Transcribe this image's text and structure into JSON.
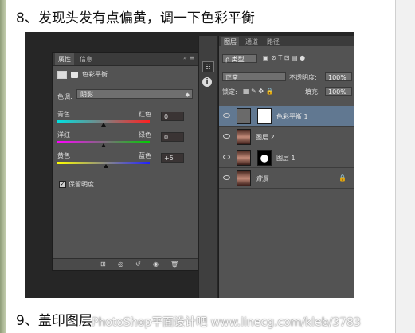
{
  "heading": "8、发现头发有点偏黄，调一下色彩平衡",
  "next_heading": "9、盖印图层",
  "watermark": "PhotoShop平面设计吧 www.linecg.com/kleb/3783",
  "properties_panel": {
    "tabs": [
      "属性",
      "信息"
    ],
    "title": "色彩平衡",
    "tone_label": "色调:",
    "tone_value": "阴影",
    "sliders": [
      {
        "left": "青色",
        "right": "红色",
        "value": "0",
        "level": 0
      },
      {
        "left": "洋红",
        "right": "绿色",
        "value": "0",
        "level": 0
      },
      {
        "left": "黄色",
        "right": "蓝色",
        "value": "+5",
        "level": 5
      }
    ],
    "preserve_luminosity_label": "保留明度",
    "preserve_luminosity_checked": true
  },
  "layers_panel": {
    "tabs": [
      "图层",
      "通道",
      "路径"
    ],
    "filter_label": "ρ 类型",
    "blend_mode": "正常",
    "opacity_label": "不透明度:",
    "opacity_value": "100%",
    "lock_label": "锁定:",
    "fill_label": "填充:",
    "fill_value": "100%",
    "layers": [
      {
        "name": "色彩平衡 1",
        "selected": true
      },
      {
        "name": "图层 2",
        "selected": false
      },
      {
        "name": "图层 1",
        "selected": false
      },
      {
        "name": "背景",
        "selected": false
      }
    ]
  },
  "colors": {
    "panel_bg": "#535353",
    "dark_bg": "#262626",
    "selected_layer": "#617891"
  }
}
